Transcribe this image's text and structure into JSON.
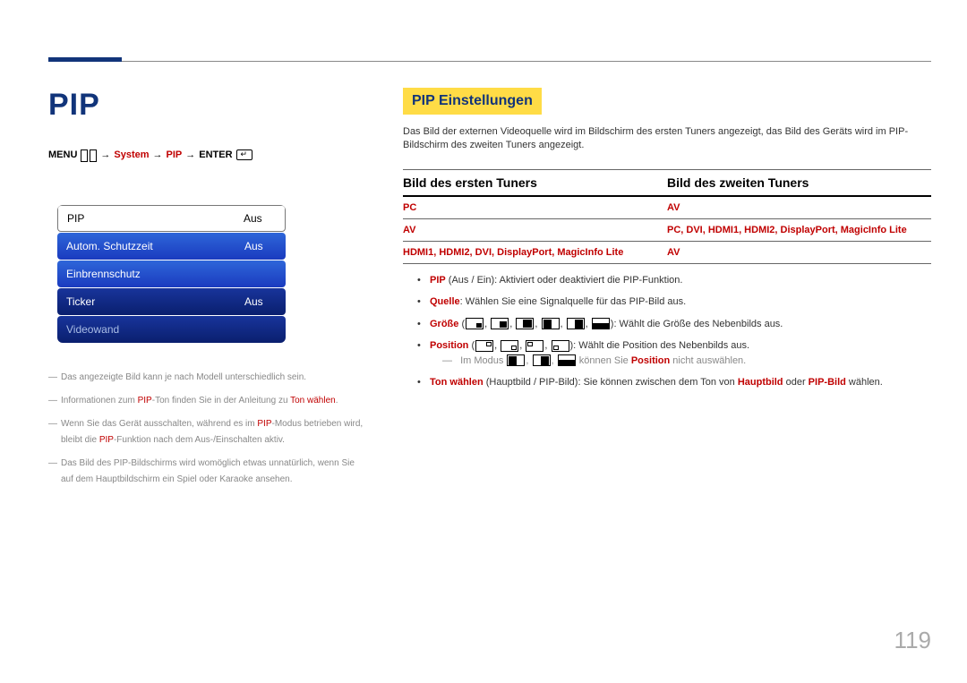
{
  "page": {
    "title": "PIP",
    "number": "119"
  },
  "breadcrumb": {
    "menu": "MENU",
    "system": "System",
    "pip": "PIP",
    "enter": "ENTER"
  },
  "menu_mock": {
    "rows": [
      {
        "label": "PIP",
        "value": "Aus"
      },
      {
        "label": "Autom. Schutzzeit",
        "value": "Aus"
      },
      {
        "label": "Einbrennschutz",
        "value": ""
      },
      {
        "label": "Ticker",
        "value": "Aus"
      },
      {
        "label": "Videowand",
        "value": ""
      }
    ]
  },
  "left_notes": [
    {
      "text": "Das angezeigte Bild kann je nach Modell unterschiedlich sein."
    },
    {
      "prefix": "Informationen zum ",
      "red1": "PIP",
      "mid": "-Ton finden Sie in der Anleitung zu ",
      "red2": "Ton wählen",
      "suffix": "."
    },
    {
      "prefix": "Wenn Sie das Gerät ausschalten, während es im ",
      "red1": "PIP",
      "mid": "-Modus betrieben wird, bleibt die ",
      "red2": "PIP",
      "suffix": "-Funktion nach dem Aus-/Einschalten aktiv."
    },
    {
      "text": "Das Bild des PIP-Bildschirms wird womöglich etwas unnatürlich, wenn Sie auf dem Hauptbildschirm ein Spiel oder Karaoke ansehen."
    }
  ],
  "right": {
    "section_title": "PIP Einstellungen",
    "intro": "Das Bild der externen Videoquelle wird im Bildschirm des ersten Tuners angezeigt, das Bild des Geräts wird im PIP-Bildschirm des zweiten Tuners angezeigt.",
    "col1_header": "Bild des ersten Tuners",
    "col2_header": "Bild des zweiten Tuners",
    "table": [
      {
        "c1": "PC",
        "c2": "AV"
      },
      {
        "c1": "AV",
        "c2": "PC, DVI, HDMI1, HDMI2, DisplayPort, MagicInfo Lite"
      },
      {
        "c1": "HDMI1, HDMI2, DVI, DisplayPort, MagicInfo Lite",
        "c2": "AV"
      }
    ],
    "bullets": {
      "pip": {
        "label": "PIP",
        "opts": " (Aus / Ein)",
        "text": ": Aktiviert oder deaktiviert die PIP-Funktion."
      },
      "quelle": {
        "label": "Quelle",
        "text": ": Wählen Sie eine Signalquelle für das PIP-Bild aus."
      },
      "groesse": {
        "label": "Größe",
        "text": ": Wählt die Größe des Nebenbilds aus."
      },
      "position": {
        "label": "Position",
        "text": ": Wählt die Position des Nebenbilds aus."
      },
      "sub_mode": {
        "pre": "Im Modus ",
        "mid": " können Sie ",
        "red": "Position",
        "post": " nicht auswählen."
      },
      "ton": {
        "label": "Ton wählen",
        "opts": " (Hauptbild / PIP-Bild)",
        "text": ": Sie können zwischen dem Ton von ",
        "r1": "Hauptbild",
        "or": " oder ",
        "r2": "PIP-Bild",
        "end": " wählen."
      }
    }
  }
}
